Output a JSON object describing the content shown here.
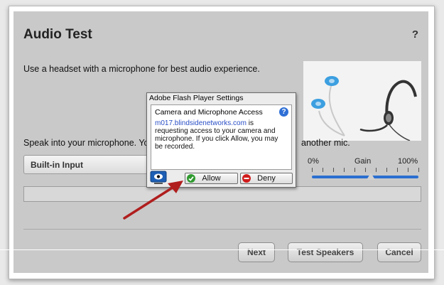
{
  "dialog": {
    "title": "Audio Test",
    "help": "?",
    "intro": "Use a headset with a microphone for best audio experience.",
    "speak_left": "Speak into your microphone. You",
    "speak_right": "another mic."
  },
  "mic_select": {
    "value": "Built-in Input"
  },
  "gain": {
    "min_label": "0%",
    "label": "Gain",
    "max_label": "100%",
    "level": 0.55
  },
  "buttons": {
    "next": "Next",
    "test_speakers": "Test Speakers",
    "cancel": "Cancel"
  },
  "flash": {
    "header": "Adobe Flash Player Settings",
    "panel_title": "Camera and Microphone Access",
    "domain": "m017.blindsidenetworks.com",
    "message": " is requesting access to your camera and microphone. If you click Allow, you may be recorded.",
    "allow": "Allow",
    "deny": "Deny"
  },
  "colors": {
    "accent": "#2a6fd0",
    "arrow": "#b01e1e",
    "allow_icon": "#2f9a2f",
    "deny_icon": "#d01c1c"
  },
  "icons": [
    "help-icon",
    "question-icon",
    "webcam-icon",
    "checkmark-icon",
    "deny-icon",
    "arrow-annotation"
  ]
}
